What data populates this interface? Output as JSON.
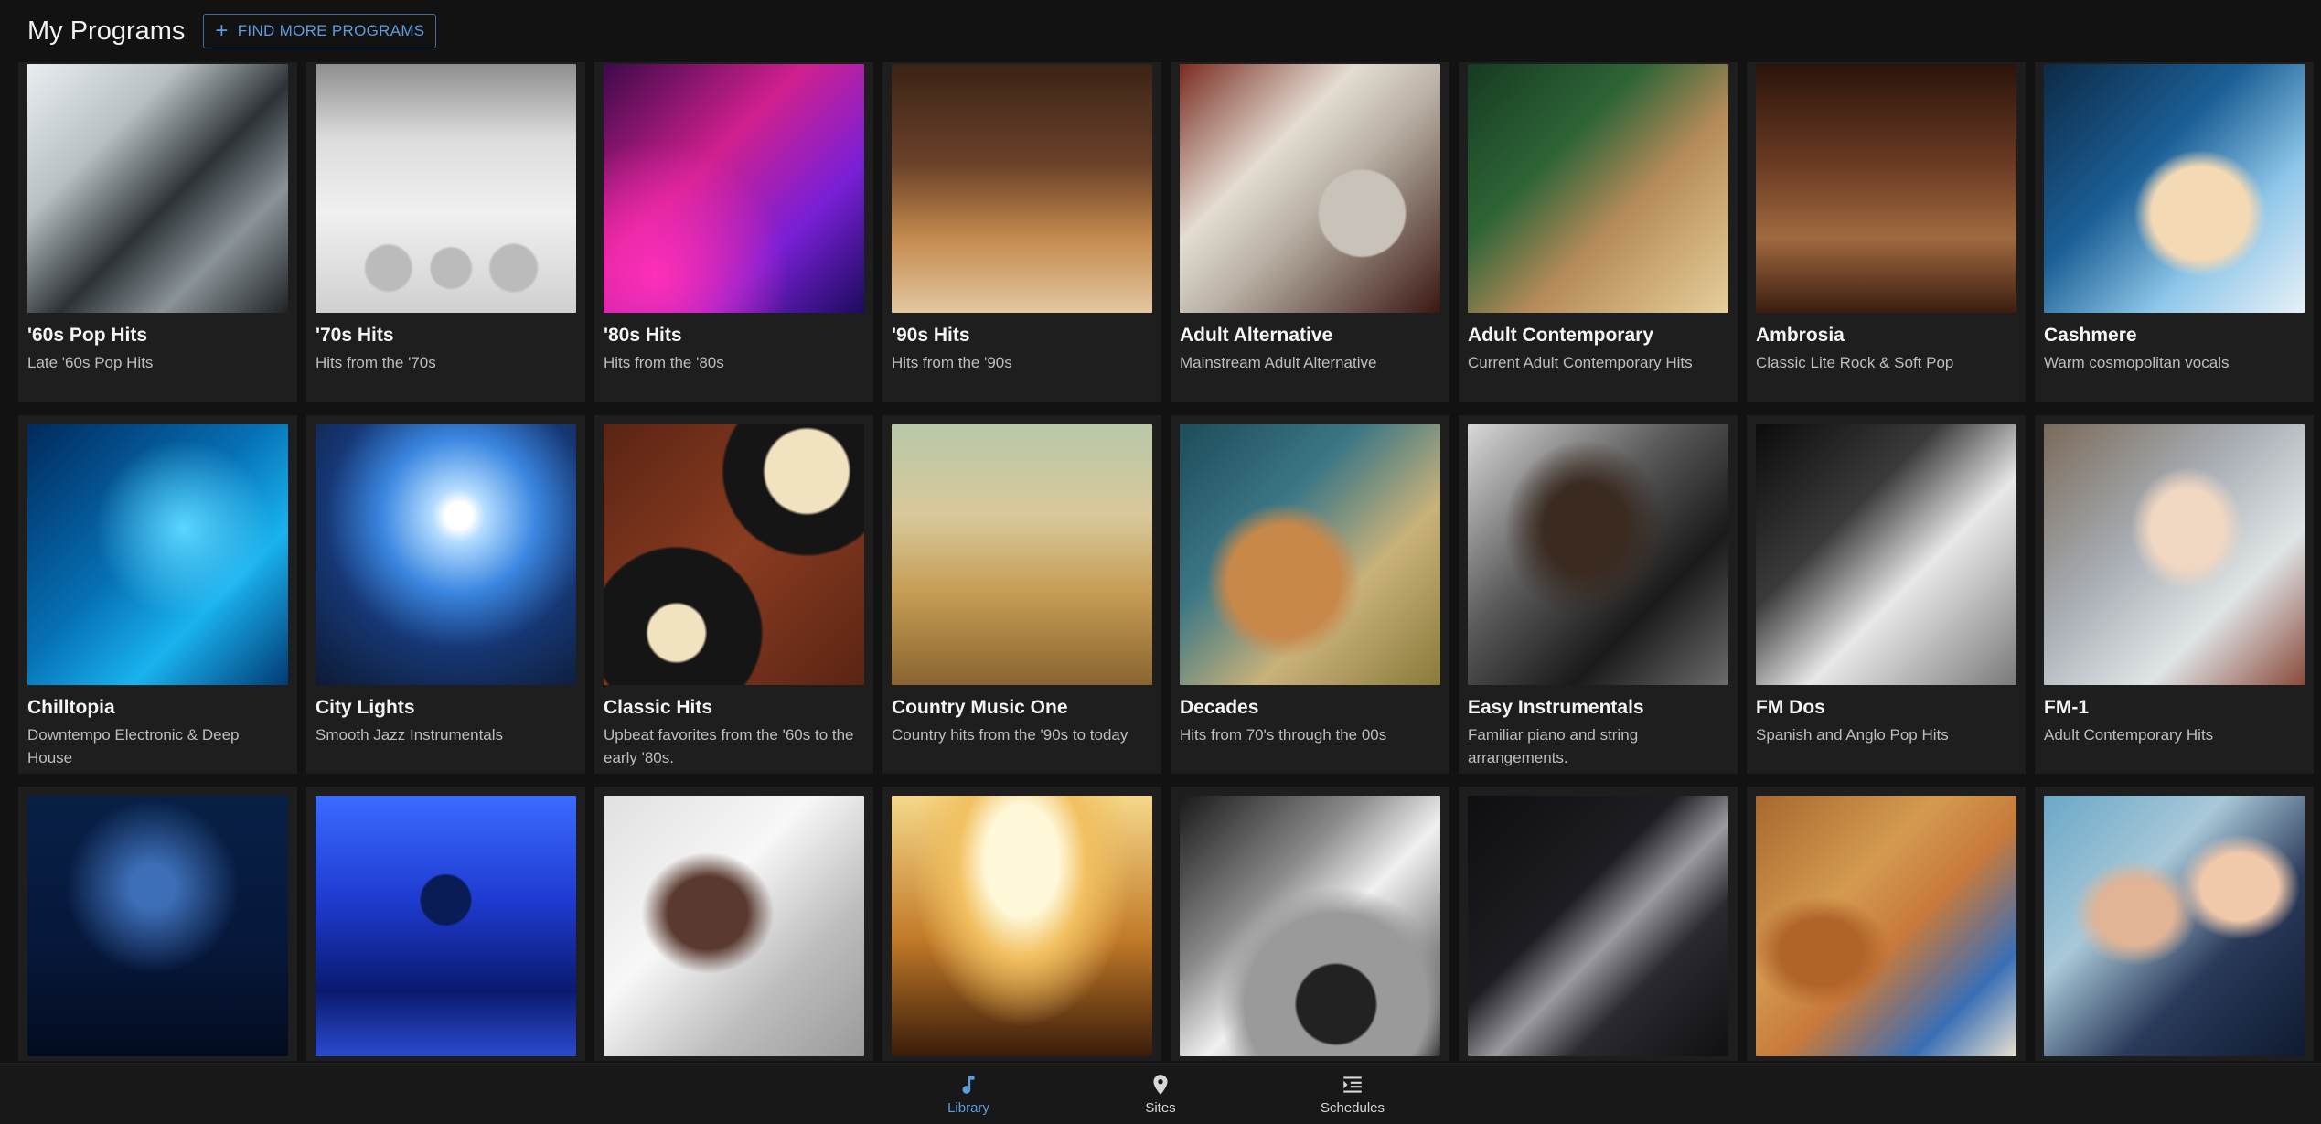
{
  "header": {
    "title": "My Programs",
    "find_button_icon": "plus-icon",
    "find_button_label": "FIND MORE PROGRAMS"
  },
  "colors": {
    "background": "#121212",
    "card": "#1e1e1e",
    "accent": "#5d9ce0"
  },
  "programs": [
    {
      "title": "'60s Pop Hits",
      "subtitle": "Late '60s Pop Hits"
    },
    {
      "title": "'70s Hits",
      "subtitle": "Hits from the '70s"
    },
    {
      "title": "'80s Hits",
      "subtitle": "Hits from the '80s"
    },
    {
      "title": "'90s Hits",
      "subtitle": "Hits from the '90s"
    },
    {
      "title": "Adult Alternative",
      "subtitle": "Mainstream Adult Alternative"
    },
    {
      "title": "Adult Contemporary",
      "subtitle": "Current Adult Contemporary Hits"
    },
    {
      "title": "Ambrosia",
      "subtitle": "Classic Lite Rock & Soft Pop"
    },
    {
      "title": "Cashmere",
      "subtitle": "Warm cosmopolitan vocals"
    },
    {
      "title": "Chilltopia",
      "subtitle": "Downtempo Electronic & Deep House"
    },
    {
      "title": "City Lights",
      "subtitle": "Smooth Jazz Instrumentals"
    },
    {
      "title": "Classic Hits",
      "subtitle": "Upbeat favorites from the '60s to the early '80s."
    },
    {
      "title": "Country Music One",
      "subtitle": "Country hits from the '90s to today"
    },
    {
      "title": "Decades",
      "subtitle": "Hits from 70's through the 00s"
    },
    {
      "title": "Easy Instrumentals",
      "subtitle": "Familiar piano and string arrangements."
    },
    {
      "title": "FM Dos",
      "subtitle": "Spanish and Anglo Pop Hits"
    },
    {
      "title": "FM-1",
      "subtitle": "Adult Contemporary Hits"
    }
  ],
  "bottom_nav": [
    {
      "label": "Library",
      "icon": "music-note-icon",
      "active": true
    },
    {
      "label": "Sites",
      "icon": "map-pin-icon",
      "active": false
    },
    {
      "label": "Schedules",
      "icon": "schedule-list-icon",
      "active": false
    }
  ]
}
